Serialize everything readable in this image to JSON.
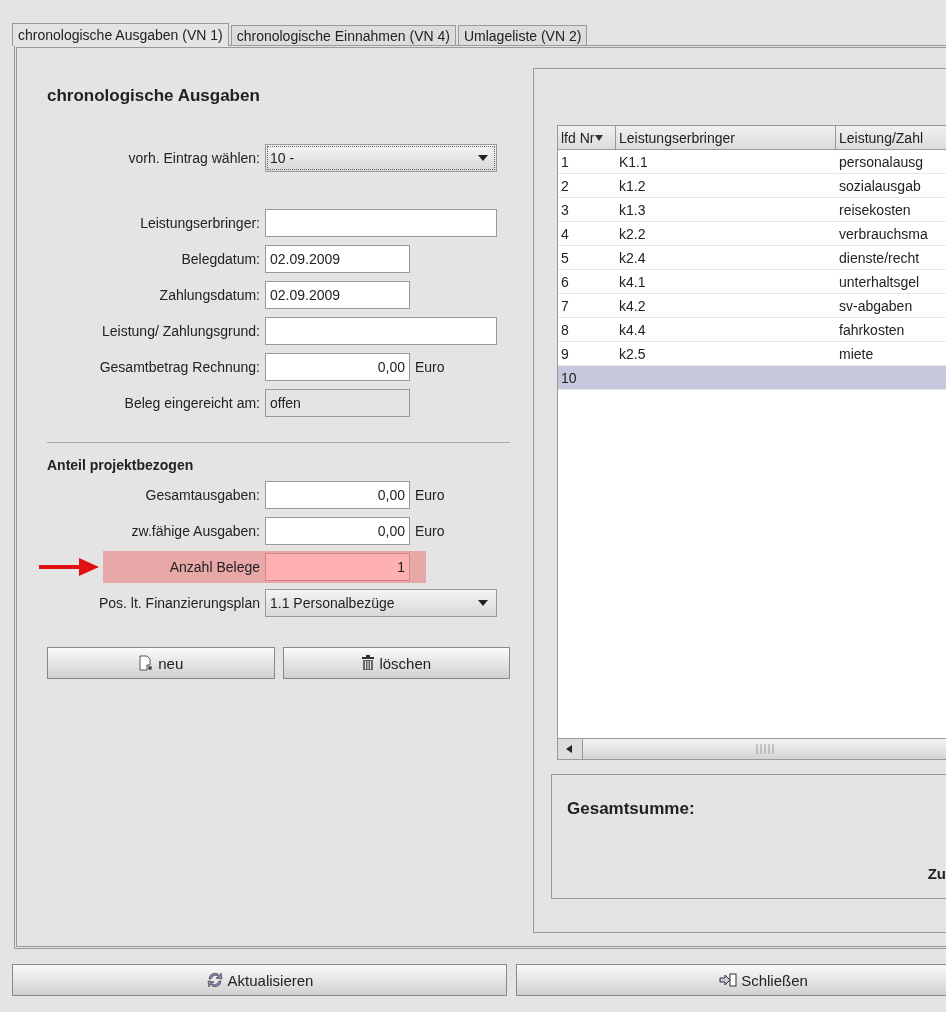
{
  "tabs": [
    {
      "label": "chronologische Ausgaben (VN 1)",
      "selected": true
    },
    {
      "label": "chronologische Einnahmen (VN 4)",
      "selected": false
    },
    {
      "label": "Umlageliste (VN 2)",
      "selected": false
    }
  ],
  "form": {
    "title": "chronologische Ausgaben",
    "entry_select": {
      "label": "vorh. Eintrag wählen:",
      "value": "10 -"
    },
    "fields": [
      {
        "kind": "text",
        "label": "Leistungserbringer:"
      },
      {
        "kind": "date",
        "label": "Belegdatum:",
        "value": "02.09.2009"
      },
      {
        "kind": "date",
        "label": "Zahlungsdatum:",
        "value": "02.09.2009"
      },
      {
        "kind": "text",
        "label": "Leistung/ Zahlungsgrund:"
      },
      {
        "kind": "number",
        "label": "Gesamtbetrag Rechnung:",
        "value": "0,00",
        "unit": "Euro"
      },
      {
        "kind": "readonly",
        "label": "Beleg eingereicht am:",
        "value": "offen"
      }
    ],
    "section_title": "Anteil projektbezogen",
    "section_fields": [
      {
        "kind": "number",
        "label": "Gesamtausgaben:",
        "value": "0,00",
        "unit": "Euro",
        "highlighted": false
      },
      {
        "kind": "number",
        "label": "zw.fähige Ausgaben:",
        "value": "0,00",
        "unit": "Euro",
        "highlighted": false
      },
      {
        "kind": "number",
        "label": "Anzahl Belege",
        "value": "1",
        "highlighted": true
      },
      {
        "kind": "select",
        "label": "Pos. lt. Finanzierungsplan",
        "value": "1.1 Personalbezüge",
        "highlighted": false
      }
    ],
    "buttons": [
      {
        "kind": "new",
        "label": "neu"
      },
      {
        "kind": "delete",
        "label": "löschen"
      }
    ]
  },
  "table": {
    "columns": [
      "lfd Nr",
      "Leistungserbringer",
      "Leistung/Zahl"
    ],
    "rows": [
      {
        "cells": [
          "1",
          "K1.1",
          "personalausg"
        ],
        "selected": false
      },
      {
        "cells": [
          "2",
          "k1.2",
          "sozialausgab"
        ],
        "selected": false
      },
      {
        "cells": [
          "3",
          "k1.3",
          "reisekosten"
        ],
        "selected": false
      },
      {
        "cells": [
          "4",
          "k2.2",
          "verbrauchsma"
        ],
        "selected": false
      },
      {
        "cells": [
          "5",
          "k2.4",
          "dienste/recht"
        ],
        "selected": false
      },
      {
        "cells": [
          "6",
          "k4.1",
          "unterhaltsgel"
        ],
        "selected": false
      },
      {
        "cells": [
          "7",
          "k4.2",
          "sv-abgaben"
        ],
        "selected": false
      },
      {
        "cells": [
          "8",
          "k4.4",
          "fahrkosten"
        ],
        "selected": false
      },
      {
        "cells": [
          "9",
          "k2.5",
          "miete"
        ],
        "selected": false
      },
      {
        "cells": [
          "10",
          "",
          ""
        ],
        "selected": true
      }
    ]
  },
  "summary": {
    "title": "Gesamtsumme:",
    "label": "Zu"
  },
  "footer_buttons": [
    {
      "kind": "refresh",
      "label": "Aktualisieren"
    },
    {
      "kind": "close",
      "label": "Schließen"
    }
  ]
}
